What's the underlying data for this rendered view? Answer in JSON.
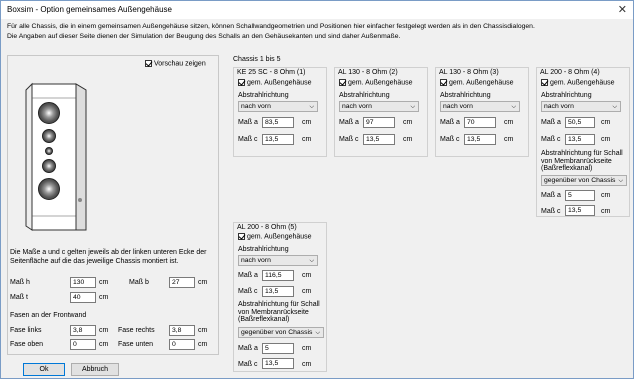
{
  "window": {
    "title": "Boxsim - Option gemeinsames Außengehäuse",
    "close": "✕"
  },
  "description": {
    "line1": "Für alle Chassis, die in einem gemeinsamen Außengehäuse sitzen, können Schallwandgeometrien und Positionen hier einfacher festgelegt werden als in den Chassisdialogen.",
    "line2": "Die Angaben auf dieser Seite dienen der Simulation der  Beugung des Schalls an den Gehäusekanten und sind daher Außenmaße."
  },
  "left": {
    "preview_label": "Vorschau zeigen",
    "info1": "Die Maße a und c gelten jeweils ab der linken unteren Ecke der",
    "info2": "Seitenfläche auf die das jeweilige Chassis montiert ist.",
    "mass_h_label": "Maß h",
    "mass_h": "130",
    "mass_h_unit": "cm",
    "mass_b_label": "Maß b",
    "mass_b": "27",
    "mass_b_unit": "cm",
    "mass_t_label": "Maß t",
    "mass_t": "40",
    "mass_t_unit": "cm",
    "fasen_label": "Fasen an der Frontwand",
    "fase_links_label": "Fase links",
    "fase_links": "3,8",
    "fase_links_unit": "cm",
    "fase_rechts_label": "Fase rechts",
    "fase_rechts": "3,8",
    "fase_rechts_unit": "cm",
    "fase_oben_label": "Fase oben",
    "fase_oben": "0",
    "fase_oben_unit": "cm",
    "fase_unten_label": "Fase unten",
    "fase_unten": "0",
    "fase_unten_unit": "cm"
  },
  "buttons": {
    "ok": "Ok",
    "cancel": "Abbruch"
  },
  "chassis": {
    "header": "Chassis 1 bis 5",
    "common_label": "gem. Außengehäuse",
    "dir_label": "Abstrahlrichtung",
    "dir_value": "nach vorn",
    "a_label": "Maß a",
    "c_label": "Maß c",
    "unit": "cm",
    "back_label": "Abstrahlrichtung für Schall von Membranrückseite (Baßreflexkanal)",
    "back_l1": "Abstrahlrichtung für Schall",
    "back_l2": "von Membranrückseite",
    "back_l3": "(Baßreflexkanal)",
    "back_value": "gegenüber von Chassis",
    "items": [
      {
        "name": "KE 25 SC - 8 Ohm   (1)",
        "a": "83,5",
        "c": "13,5"
      },
      {
        "name": "AL 130 - 8 Ohm (2)",
        "a": "97",
        "c": "13,5"
      },
      {
        "name": "AL 130 - 8 Ohm (3)",
        "a": "70",
        "c": "13,5"
      },
      {
        "name": "AL 200 - 8 Ohm (4)",
        "a": "50,5",
        "c": "13,5",
        "back_a": "5",
        "back_c": "13,5"
      },
      {
        "name": "AL 200 - 8 Ohm (5)",
        "a": "116,5",
        "c": "13,5",
        "back_a": "5",
        "back_c": "13,5"
      }
    ]
  }
}
